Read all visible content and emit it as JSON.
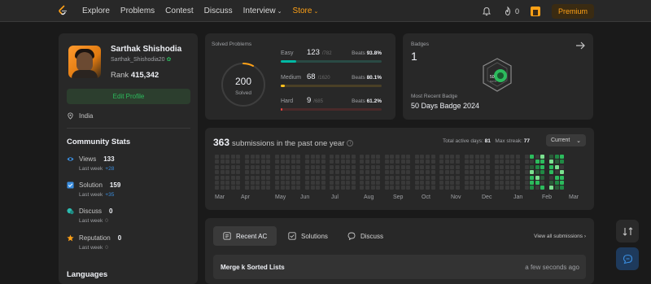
{
  "nav": {
    "links": [
      "Explore",
      "Problems",
      "Contest",
      "Discuss",
      "Interview",
      "Store"
    ],
    "streak": "0",
    "premium": "Premium"
  },
  "profile": {
    "name": "Sarthak Shishodia",
    "username": "Sarthak_Shishodia20",
    "rank_label": "Rank",
    "rank": "415,342",
    "edit": "Edit Profile",
    "location": "India",
    "community_title": "Community Stats",
    "stats": [
      {
        "label": "Views",
        "value": "133",
        "sub": "Last week",
        "delta": "+28"
      },
      {
        "label": "Solution",
        "value": "159",
        "sub": "Last week",
        "delta": "+35"
      },
      {
        "label": "Discuss",
        "value": "0",
        "sub": "Last week",
        "delta": "0"
      },
      {
        "label": "Reputation",
        "value": "0",
        "sub": "Last week",
        "delta": "0"
      }
    ],
    "languages_title": "Languages"
  },
  "solved": {
    "title": "Solved Problems",
    "total": "200",
    "total_label": "Solved",
    "rows": [
      {
        "name": "Easy",
        "count": "123",
        "total": "/782",
        "beats_label": "Beats",
        "beats": "93.8%",
        "fraction": 0.157,
        "color": "#00b8a3",
        "track": "#2a4a44"
      },
      {
        "name": "Medium",
        "count": "68",
        "total": "/1620",
        "beats_label": "Beats",
        "beats": "80.1%",
        "fraction": 0.042,
        "color": "#ffc01e",
        "track": "#4a4026"
      },
      {
        "name": "Hard",
        "count": "9",
        "total": "/685",
        "beats_label": "Beats",
        "beats": "61.2%",
        "fraction": 0.013,
        "color": "#ef4743",
        "track": "#4a2a2a"
      }
    ]
  },
  "badges": {
    "title": "Badges",
    "count": "1",
    "recent_label": "Most Recent Badge",
    "recent": "50 Days Badge 2024",
    "badge_text": "50",
    "badge_sub": "DAYS"
  },
  "heatmap": {
    "count": "363",
    "title": "submissions in the past one year",
    "active_label": "Total active days:",
    "active": "81",
    "streak_label": "Max streak:",
    "streak": "77",
    "select": "Current",
    "months": [
      "Mar",
      "Apr",
      "May",
      "Jun",
      "Jul",
      "Aug",
      "Sep",
      "Oct",
      "Nov",
      "Dec",
      "Jan",
      "Feb",
      "Mar"
    ]
  },
  "tabs": {
    "items": [
      "Recent AC",
      "Solutions",
      "Discuss"
    ],
    "view_all": "View all submissions",
    "row_title": "Merge k Sorted Lists",
    "row_time": "a few seconds ago"
  }
}
